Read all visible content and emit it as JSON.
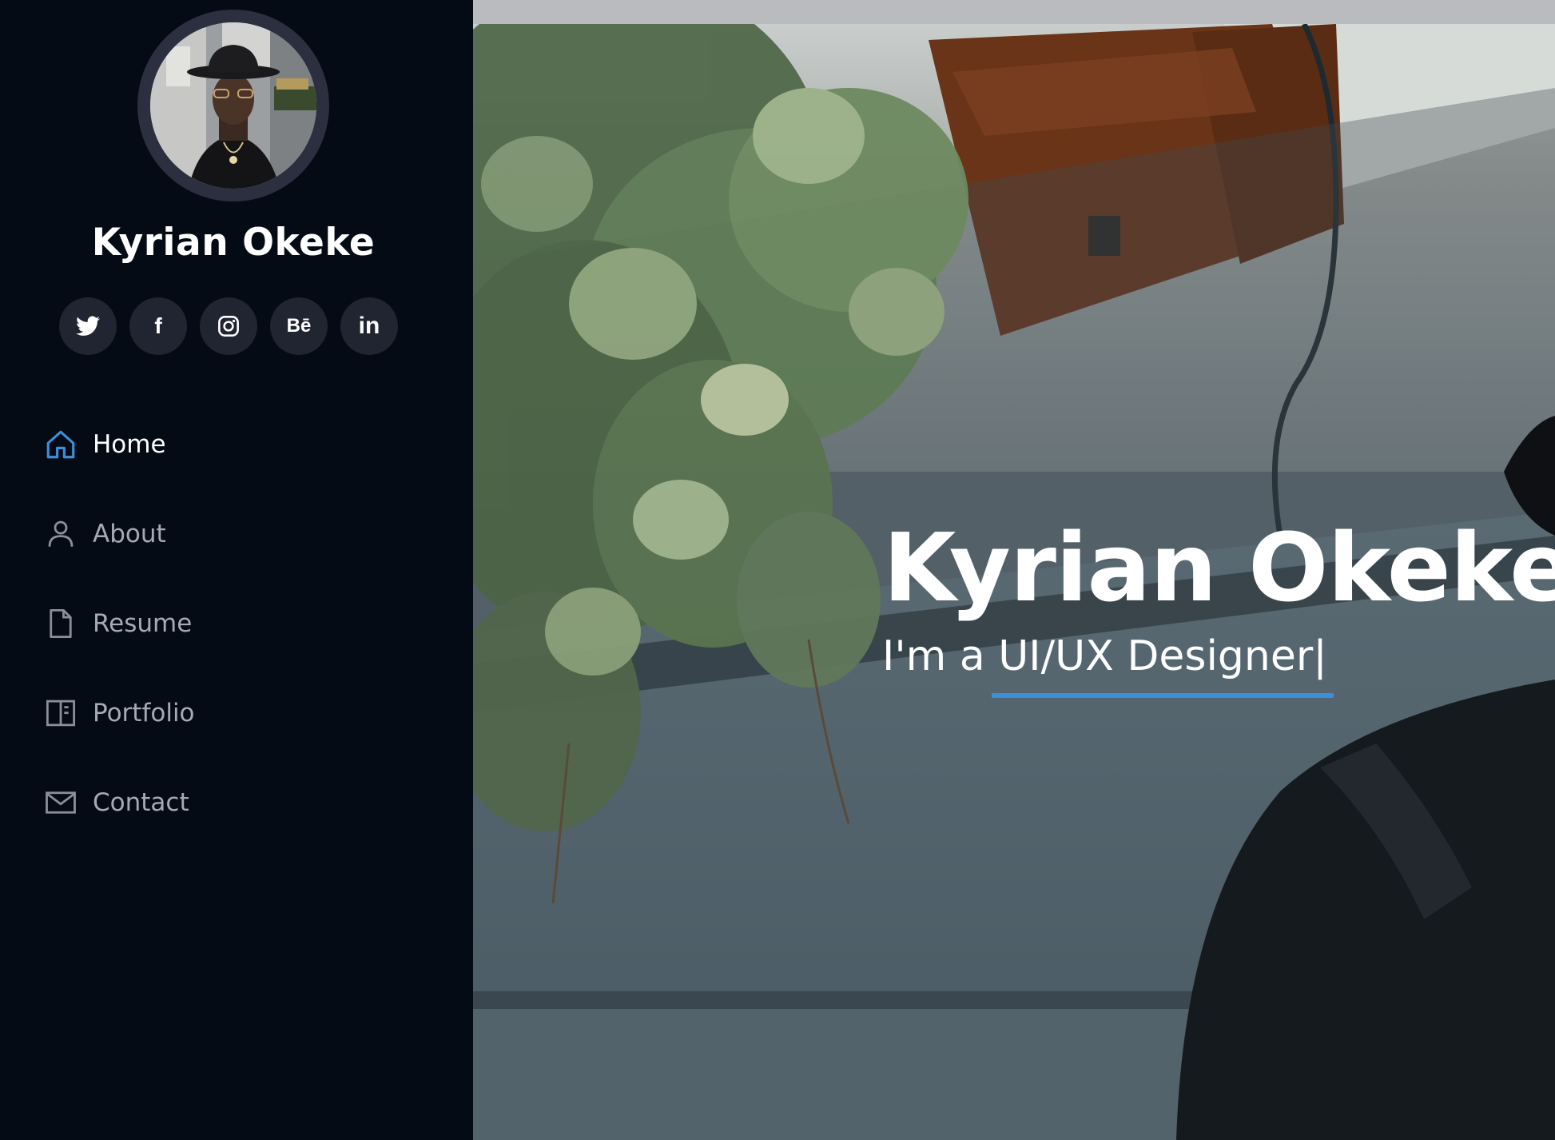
{
  "profile": {
    "name": "Kyrian Okeke",
    "avatar_icon": "profile-photo"
  },
  "social": [
    {
      "name": "twitter",
      "icon": "twitter-icon"
    },
    {
      "name": "facebook",
      "icon": "facebook-icon",
      "glyph": "f"
    },
    {
      "name": "instagram",
      "icon": "instagram-icon"
    },
    {
      "name": "behance",
      "icon": "behance-icon",
      "glyph": "Bē"
    },
    {
      "name": "linkedin",
      "icon": "linkedin-icon",
      "glyph": "in"
    }
  ],
  "nav": {
    "items": [
      {
        "label": "Home",
        "icon": "home-icon",
        "active": true
      },
      {
        "label": "About",
        "icon": "user-icon",
        "active": false
      },
      {
        "label": "Resume",
        "icon": "file-icon",
        "active": false
      },
      {
        "label": "Portfolio",
        "icon": "book-half-icon",
        "active": false
      },
      {
        "label": "Contact",
        "icon": "envelope-icon",
        "active": false
      }
    ]
  },
  "hero": {
    "title": "Kyrian Okeke",
    "subtitle": "I'm a UI/UX Designer|"
  },
  "colors": {
    "sidebar_bg": "#040b14",
    "social_bg": "#212431",
    "accent": "#3d8fd9",
    "nav_text": "#a8a9b4",
    "active_text": "#ffffff"
  }
}
